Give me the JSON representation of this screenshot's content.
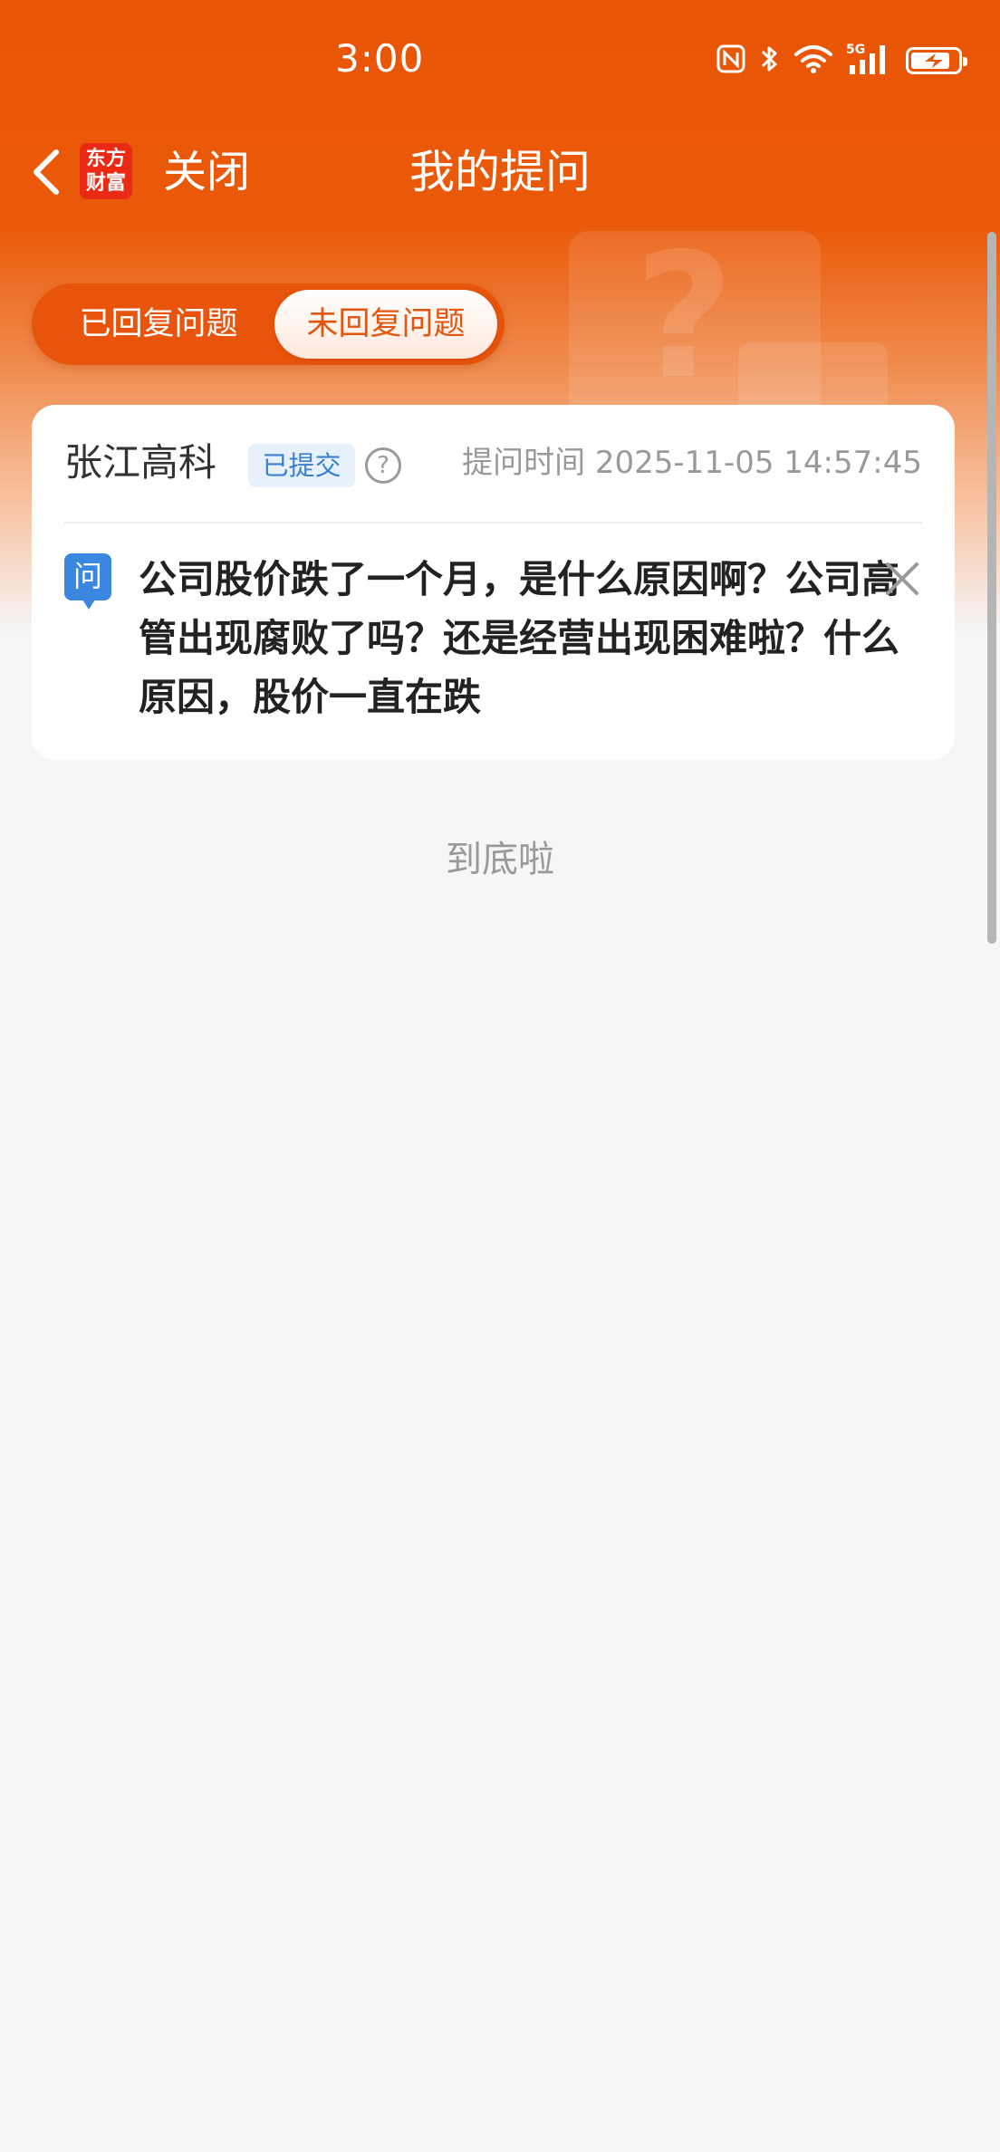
{
  "status_bar": {
    "time": "3:00",
    "icons": [
      "nfc-icon",
      "bluetooth-icon",
      "wifi-icon",
      "signal-5g-icon",
      "battery-charging-icon"
    ],
    "network_label": "5G"
  },
  "nav": {
    "logo_line1": "东方",
    "logo_line2": "财富",
    "close_label": "关闭",
    "title": "我的提问"
  },
  "tabs": {
    "replied": "已回复问题",
    "unreplied": "未回复问题",
    "active": "unreplied"
  },
  "question": {
    "company": "张江高科",
    "status_badge": "已提交",
    "help_glyph": "?",
    "time_label": "提问时间 2025-11-05 14:57:45",
    "tag": "问",
    "text": "公司股价跌了一个月，是什么原因啊？公司高管出现腐败了吗？还是经营出现困难啦？什么原因，股价一直在跌"
  },
  "footer": {
    "end_text": "到底啦"
  },
  "colors": {
    "brand_orange": "#e95406",
    "badge_blue": "#3b86de",
    "logo_red": "#ea2a14",
    "background": "#f5f6f8"
  }
}
